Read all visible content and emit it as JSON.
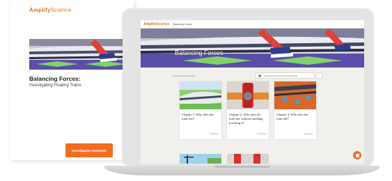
{
  "notebook": {
    "logo_brand": "Amplify",
    "logo_product": "Science",
    "title": "Balancing Forces:",
    "subtitle": "Investigating Floating Trains",
    "button_label": "Investigation Notebook"
  },
  "app": {
    "logo": "AmplifyScience",
    "breadcrumb": "Balancing Forces",
    "hero_title": "Balancing Forces",
    "tool_label": "Jump back to last lesson",
    "select_value": "Unlocked by Previously Visited/Locked",
    "select_icon": "filter-icon",
    "arrow_icon": "chevron-icon",
    "fab_icon": "notebook-icon",
    "accent_color": "#f26d21"
  },
  "chapters": [
    {
      "title": "Chapter 1: Why does the train rise?",
      "meta": "5 Lessons"
    },
    {
      "title": "Chapter 2: Why does the train rise without anything touching it?",
      "meta": "8 Lessons"
    },
    {
      "title": "Chapter 3: Why does the train fall?",
      "meta": "3 Lessons"
    }
  ]
}
